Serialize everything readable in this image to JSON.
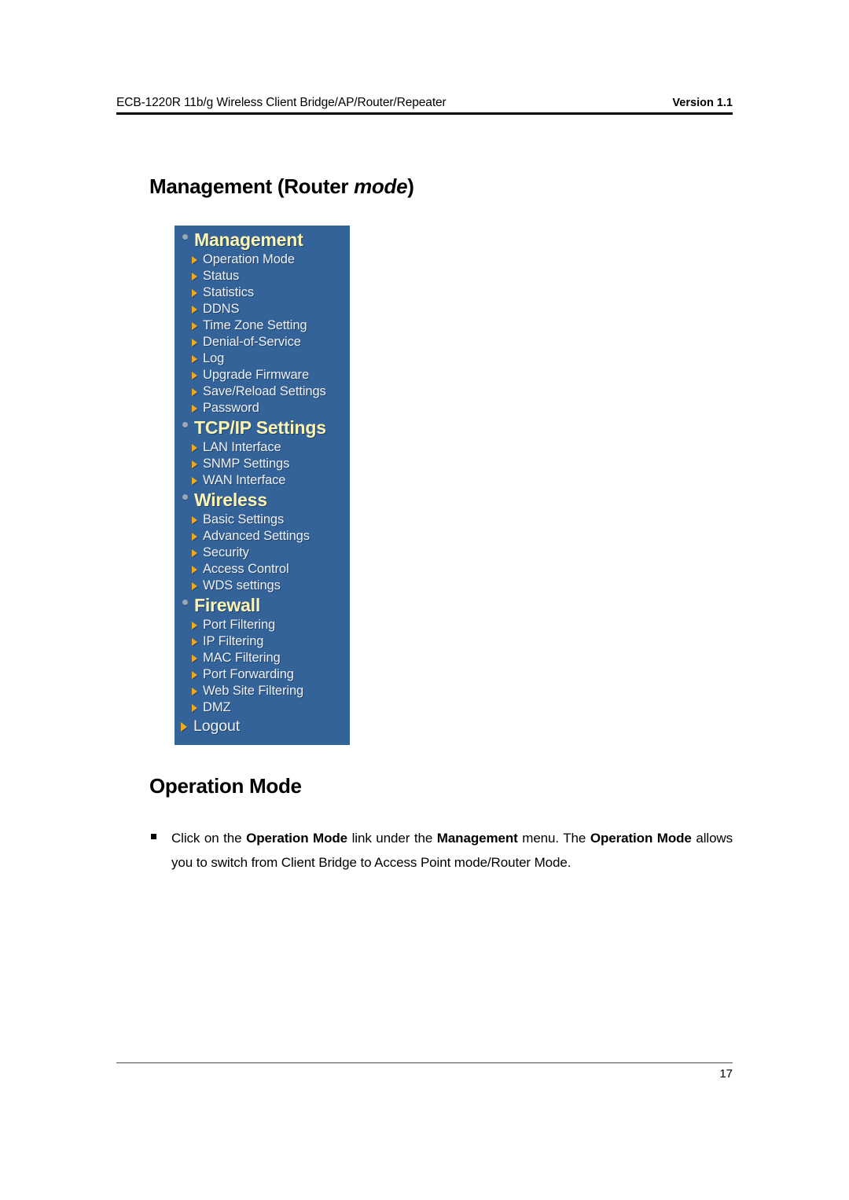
{
  "header": {
    "left_text": "ECB-1220R 11b/g Wireless Client Bridge/AP/Router/Repeater",
    "right_text": "Version 1.1"
  },
  "titles": {
    "management_prefix": "Management (Router ",
    "management_italic": "mode",
    "management_suffix": ")",
    "operation_mode": "Operation Mode"
  },
  "nav_panel": {
    "background_color": "#34639a",
    "heading_color": "#fbf5b4",
    "item_color": "#eef2f7",
    "arrow_color": "#f0a81e",
    "sections": [
      {
        "heading": "Management",
        "items": [
          "Operation Mode",
          "Status",
          "Statistics",
          "DDNS",
          "Time Zone Setting",
          "Denial-of-Service",
          "Log",
          "Upgrade Firmware",
          "Save/Reload Settings",
          "Password"
        ]
      },
      {
        "heading": "TCP/IP Settings",
        "items": [
          "LAN Interface",
          "SNMP Settings",
          "WAN Interface"
        ]
      },
      {
        "heading": "Wireless",
        "items": [
          "Basic Settings",
          "Advanced Settings",
          "Security",
          "Access Control",
          "WDS settings"
        ]
      },
      {
        "heading": "Firewall",
        "items": [
          "Port Filtering",
          "IP Filtering",
          "MAC Filtering",
          "Port Forwarding",
          "Web Site Filtering",
          "DMZ"
        ]
      }
    ],
    "logout": "Logout"
  },
  "body": {
    "paragraph_runs": [
      {
        "text": "Click on the ",
        "bold": false
      },
      {
        "text": "Operation Mode",
        "bold": true
      },
      {
        "text": " link under the ",
        "bold": false
      },
      {
        "text": "Management",
        "bold": true
      },
      {
        "text": " menu. The ",
        "bold": false
      },
      {
        "text": "Operation Mode",
        "bold": true
      },
      {
        "text": " allows you to switch from Client Bridge to Access Point mode/Router Mode.",
        "bold": false
      }
    ]
  },
  "footer": {
    "page_number": "17"
  }
}
